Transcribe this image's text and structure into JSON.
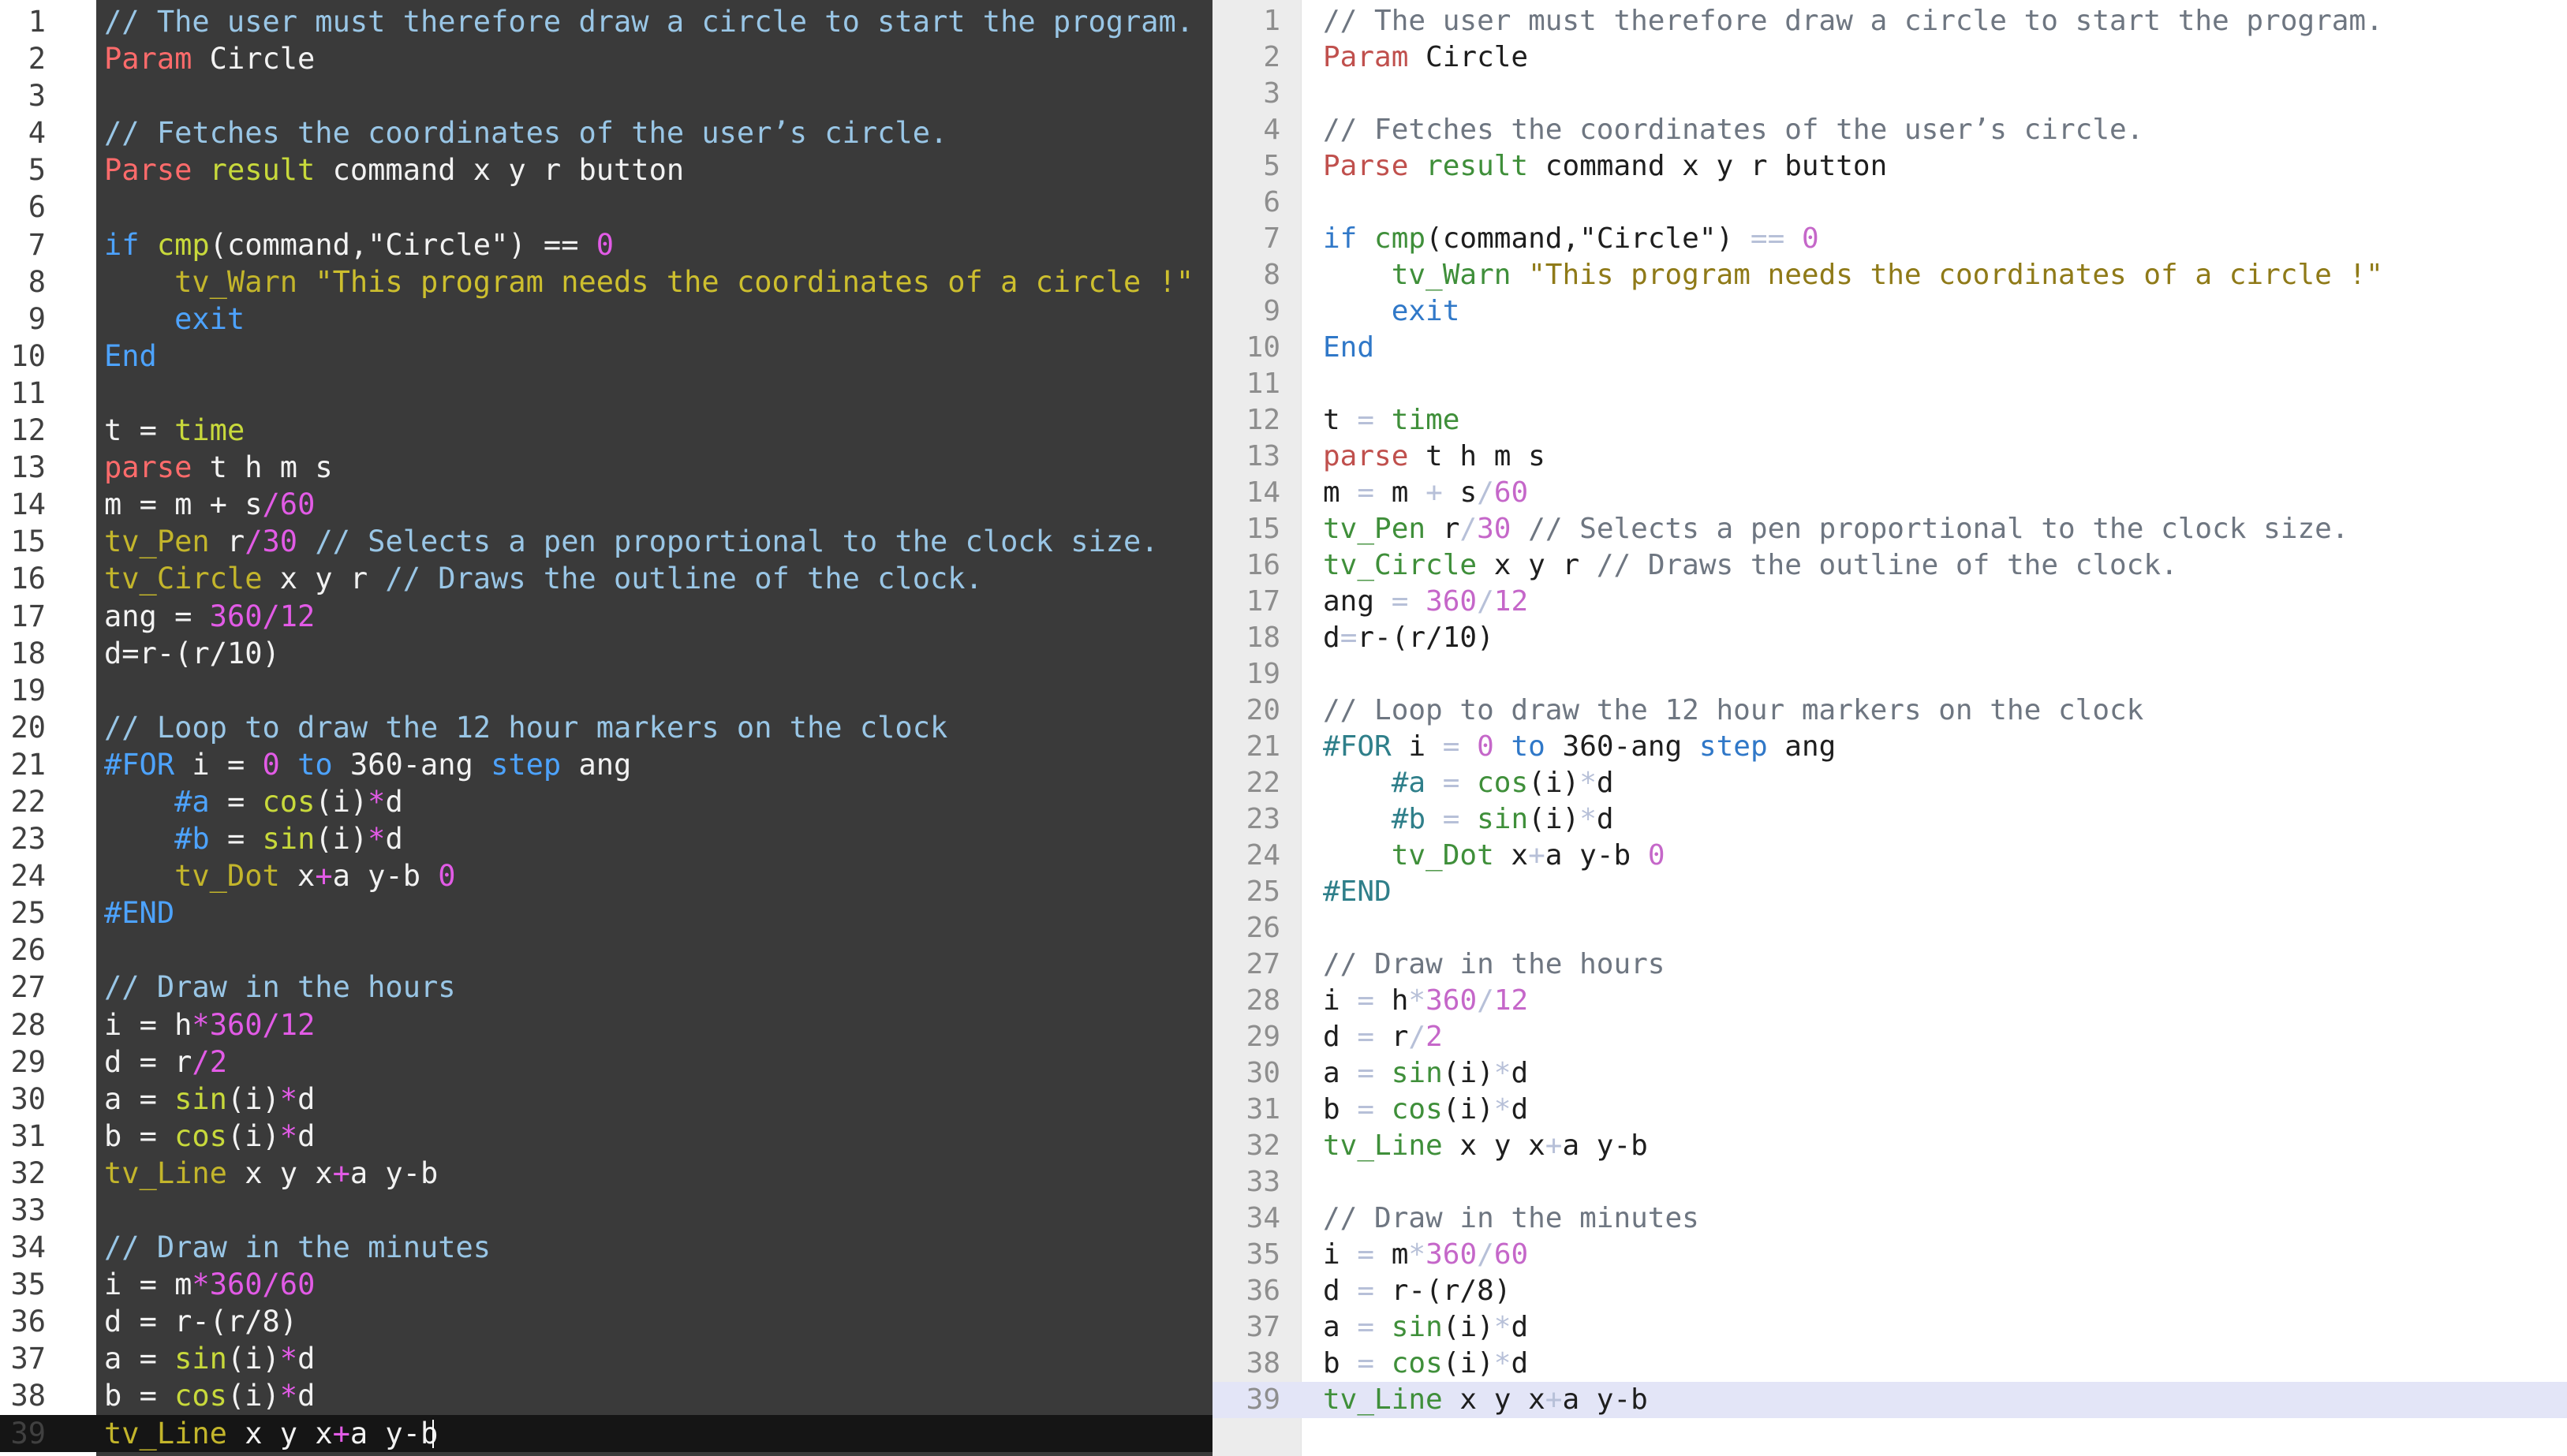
{
  "colors": {
    "dark_background": "#3a3a3a",
    "dark_gutter": "#ffffff",
    "light_background": "#ffffff",
    "light_gutter": "#ececec",
    "light_current_line": "#e3e5f7"
  },
  "lines": [
    [
      [
        "cm",
        "// The user must therefore draw a circle to start the program."
      ]
    ],
    [
      [
        "kw",
        "Param"
      ],
      [
        "id",
        " Circle"
      ]
    ],
    [],
    [
      [
        "cm",
        "// Fetches the coordinates of the user’s circle."
      ]
    ],
    [
      [
        "kw",
        "Parse"
      ],
      [
        "id",
        " "
      ],
      [
        "bi",
        "result"
      ],
      [
        "id",
        " command x y r button"
      ]
    ],
    [],
    [
      [
        "fl",
        "if"
      ],
      [
        "id",
        " "
      ],
      [
        "bi",
        "cmp"
      ],
      [
        "id",
        "(command,\"Circle\") "
      ],
      [
        "op",
        "=="
      ],
      [
        "id",
        " "
      ],
      [
        "nu",
        "0"
      ]
    ],
    [
      [
        "id",
        "    "
      ],
      [
        "tv",
        "tv_Warn"
      ],
      [
        "id",
        " "
      ],
      [
        "st",
        "\"This program needs the coordinates of a circle !\""
      ]
    ],
    [
      [
        "id",
        "    "
      ],
      [
        "ex",
        "exit"
      ]
    ],
    [
      [
        "fl",
        "End"
      ]
    ],
    [],
    [
      [
        "id",
        "t "
      ],
      [
        "op",
        "="
      ],
      [
        "id",
        " "
      ],
      [
        "bi",
        "time"
      ]
    ],
    [
      [
        "kw",
        "parse"
      ],
      [
        "id",
        " t h m s"
      ]
    ],
    [
      [
        "id",
        "m "
      ],
      [
        "op",
        "="
      ],
      [
        "id",
        " m "
      ],
      [
        "op",
        "+"
      ],
      [
        "id",
        " s"
      ],
      [
        "op2",
        "/"
      ],
      [
        "nu",
        "60"
      ]
    ],
    [
      [
        "tv",
        "tv_Pen"
      ],
      [
        "id",
        " r"
      ],
      [
        "op2",
        "/"
      ],
      [
        "nu",
        "30"
      ],
      [
        "id",
        " "
      ],
      [
        "cm",
        "// Selects a pen proportional to the clock size."
      ]
    ],
    [
      [
        "tv",
        "tv_Circle"
      ],
      [
        "id",
        " x y r "
      ],
      [
        "cm",
        "// Draws the outline of the clock."
      ]
    ],
    [
      [
        "id",
        "ang "
      ],
      [
        "op",
        "="
      ],
      [
        "id",
        " "
      ],
      [
        "nu",
        "360"
      ],
      [
        "op2",
        "/"
      ],
      [
        "nu",
        "12"
      ]
    ],
    [
      [
        "id",
        "d"
      ],
      [
        "op",
        "="
      ],
      [
        "id",
        "r-(r/10)"
      ]
    ],
    [],
    [
      [
        "cm",
        "// Loop to draw the 12 hour markers on the clock"
      ]
    ],
    [
      [
        "pp",
        "#FOR"
      ],
      [
        "id",
        " i "
      ],
      [
        "op",
        "="
      ],
      [
        "id",
        " "
      ],
      [
        "nu",
        "0"
      ],
      [
        "id",
        " "
      ],
      [
        "fl",
        "to"
      ],
      [
        "id",
        " 360-ang "
      ],
      [
        "fl",
        "step"
      ],
      [
        "id",
        " ang"
      ]
    ],
    [
      [
        "id",
        "    "
      ],
      [
        "pp",
        "#a"
      ],
      [
        "id",
        " "
      ],
      [
        "op",
        "="
      ],
      [
        "id",
        " "
      ],
      [
        "bi",
        "cos"
      ],
      [
        "id",
        "(i)"
      ],
      [
        "op2",
        "*"
      ],
      [
        "id",
        "d"
      ]
    ],
    [
      [
        "id",
        "    "
      ],
      [
        "pp",
        "#b"
      ],
      [
        "id",
        " "
      ],
      [
        "op",
        "="
      ],
      [
        "id",
        " "
      ],
      [
        "bi",
        "sin"
      ],
      [
        "id",
        "(i)"
      ],
      [
        "op2",
        "*"
      ],
      [
        "id",
        "d"
      ]
    ],
    [
      [
        "id",
        "    "
      ],
      [
        "tv",
        "tv_Dot"
      ],
      [
        "id",
        " x"
      ],
      [
        "op2",
        "+"
      ],
      [
        "id",
        "a y-b "
      ],
      [
        "nu",
        "0"
      ]
    ],
    [
      [
        "pp",
        "#END"
      ]
    ],
    [],
    [
      [
        "cm",
        "// Draw in the hours"
      ]
    ],
    [
      [
        "id",
        "i "
      ],
      [
        "op",
        "="
      ],
      [
        "id",
        " h"
      ],
      [
        "op2",
        "*"
      ],
      [
        "nu",
        "360"
      ],
      [
        "op2",
        "/"
      ],
      [
        "nu",
        "12"
      ]
    ],
    [
      [
        "id",
        "d "
      ],
      [
        "op",
        "="
      ],
      [
        "id",
        " r"
      ],
      [
        "op2",
        "/"
      ],
      [
        "nu",
        "2"
      ]
    ],
    [
      [
        "id",
        "a "
      ],
      [
        "op",
        "="
      ],
      [
        "id",
        " "
      ],
      [
        "bi",
        "sin"
      ],
      [
        "id",
        "(i)"
      ],
      [
        "op2",
        "*"
      ],
      [
        "id",
        "d"
      ]
    ],
    [
      [
        "id",
        "b "
      ],
      [
        "op",
        "="
      ],
      [
        "id",
        " "
      ],
      [
        "bi",
        "cos"
      ],
      [
        "id",
        "(i)"
      ],
      [
        "op2",
        "*"
      ],
      [
        "id",
        "d"
      ]
    ],
    [
      [
        "tv",
        "tv_Line"
      ],
      [
        "id",
        " x y x"
      ],
      [
        "op2",
        "+"
      ],
      [
        "id",
        "a y-b"
      ]
    ],
    [],
    [
      [
        "cm",
        "// Draw in the minutes"
      ]
    ],
    [
      [
        "id",
        "i "
      ],
      [
        "op",
        "="
      ],
      [
        "id",
        " m"
      ],
      [
        "op2",
        "*"
      ],
      [
        "nu",
        "360"
      ],
      [
        "op2",
        "/"
      ],
      [
        "nu",
        "60"
      ]
    ],
    [
      [
        "id",
        "d "
      ],
      [
        "op",
        "="
      ],
      [
        "id",
        " r-(r/8)"
      ]
    ],
    [
      [
        "id",
        "a "
      ],
      [
        "op",
        "="
      ],
      [
        "id",
        " "
      ],
      [
        "bi",
        "sin"
      ],
      [
        "id",
        "(i)"
      ],
      [
        "op2",
        "*"
      ],
      [
        "id",
        "d"
      ]
    ],
    [
      [
        "id",
        "b "
      ],
      [
        "op",
        "="
      ],
      [
        "id",
        " "
      ],
      [
        "bi",
        "cos"
      ],
      [
        "id",
        "(i)"
      ],
      [
        "op2",
        "*"
      ],
      [
        "id",
        "d"
      ]
    ],
    [
      [
        "tv",
        "tv_Line"
      ],
      [
        "id",
        " x y x"
      ],
      [
        "op2",
        "+"
      ],
      [
        "id",
        "a y-b"
      ]
    ]
  ],
  "current_line": 39
}
